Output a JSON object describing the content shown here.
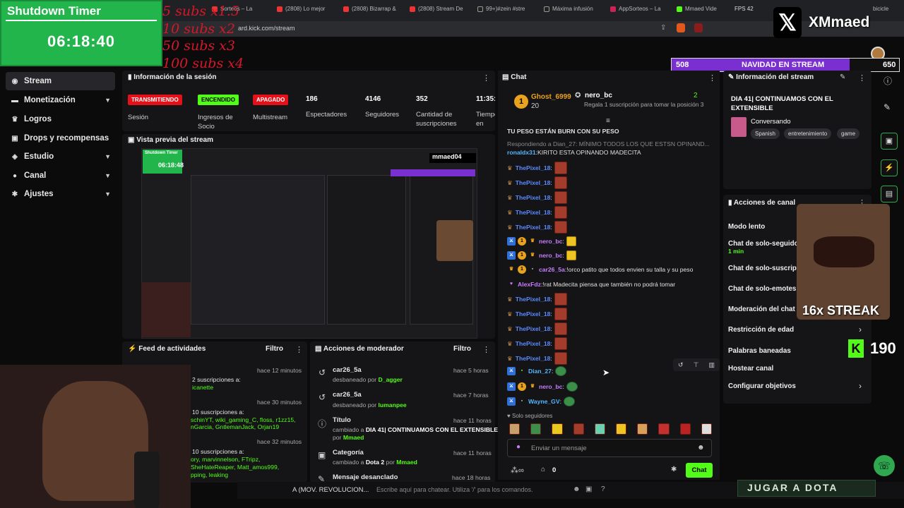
{
  "browser": {
    "tabs": [
      "Sorteos – La",
      "(2808) Lo mejor",
      "(2808) Bizarrap &",
      "(2808) Stream De",
      "99+)#zein #stre",
      "Máxima infusión",
      "AppSorteos – La",
      "Mmaed Vide",
      "FPS 42",
      "bicicle"
    ],
    "url": "ard.kick.com/stream"
  },
  "overlay": {
    "timer_title": "Shutdown Timer",
    "timer_time": "06:18:40",
    "subs_goals": [
      "5 subs x1.5",
      "10 subs x2",
      "50 subs x3",
      "100 subs x4"
    ],
    "x_handle": "XMmaed",
    "goal_left": "508",
    "goal_title": "NAVIDAD EN STREAM",
    "goal_right": "650",
    "streak_text": "16x STREAK",
    "kick_count": "190",
    "jugar": "JUGAR A DOTA"
  },
  "sidebar": {
    "items": [
      {
        "label": "Stream",
        "icon": "stream-icon"
      },
      {
        "label": "Monetización",
        "icon": "money-icon"
      },
      {
        "label": "Logros",
        "icon": "trophy-icon"
      },
      {
        "label": "Drops y recompensas",
        "icon": "gift-icon"
      },
      {
        "label": "Estudio",
        "icon": "studio-icon"
      },
      {
        "label": "Canal",
        "icon": "person-icon"
      },
      {
        "label": "Ajustes",
        "icon": "gear-icon"
      }
    ]
  },
  "session": {
    "title": "Información de la sesión",
    "badges": [
      {
        "text": "TRANSMITIENDO",
        "label": "Sesión",
        "color": "#e4111b"
      },
      {
        "text": "ENCENDIDO",
        "label": "Ingresos de Socio",
        "color": "#53fc18"
      },
      {
        "text": "APAGADO",
        "label": "Multistream",
        "color": "#e4111b"
      }
    ],
    "stats": [
      {
        "value": "186",
        "label": "Espectadores"
      },
      {
        "value": "4146",
        "label": "Seguidores"
      },
      {
        "value": "352",
        "label": "Cantidad de suscripciones"
      },
      {
        "value": "11:35:",
        "label": "Tiempo en vivo"
      }
    ]
  },
  "preview": {
    "title": "Vista previa del stream",
    "mini_timer_title": "Shutdown Timer",
    "mini_timer_time": "06:18:48",
    "mini_handle": "mmaed04"
  },
  "activity": {
    "title": "Feed de actividades",
    "filter": "Filtro",
    "items": [
      {
        "time": "hace 12 minutos",
        "line1": "2 suscripciones a:",
        "line2": "icanette"
      },
      {
        "time": "hace 30 minutos",
        "line1": "10 suscripciones a:",
        "line2": "schinYT, wiki_gaming_C, floss, r1zz15,",
        "line3": "nGarcia, GntlemanJack, Orjan19"
      },
      {
        "time": "hace 32 minutos",
        "line1": "10 suscripciones a:",
        "line2": "ory, marvinnelson, FTripz,",
        "line3": "SheHateReaper, Matt_amos999,",
        "line4": "pping, leaking"
      }
    ]
  },
  "modactions": {
    "title": "Acciones de moderador",
    "filter": "Filtro",
    "items": [
      {
        "name": "car26_5a",
        "time": "hace 5 horas",
        "desc": "desbaneado por",
        "by": "D_agger"
      },
      {
        "name": "car26_5a",
        "time": "hace 7 horas",
        "desc": "desbaneado por",
        "by": "lumanpee"
      },
      {
        "name": "Título",
        "time": "hace 11 horas",
        "desc": "cambiado a",
        "value": "DIA 41| CONTINUAMOS CON EL EXTENSIBLE",
        "by_prefix": "por",
        "by": "Mmaed"
      },
      {
        "name": "Categoría",
        "time": "hace 11 horas",
        "desc": "cambiado a",
        "value": "Dota 2",
        "by_prefix": "por",
        "by": "Mmaed"
      },
      {
        "name": "Mensaje desanclado",
        "time": "hace 18 horas"
      }
    ]
  },
  "chat": {
    "title": "Chat",
    "top_user": "Ghost_6999",
    "top_amount": "20",
    "gift_user": "nero_bc",
    "gift_count": "2",
    "gift_text": "Regala 1 suscripción para tomar la posición 3",
    "messages": [
      {
        "user": "",
        "text": "TU PESO ESTÁN BURN CON SU PESO"
      },
      {
        "user": "",
        "text": "Respondiendo a Dian_27: MÍNIMO TODOS LOS QUE ESTSN OPINAND..."
      },
      {
        "user": "ronaldx31",
        "text": "KIRITO ESTA OPINANDO MADECITA"
      },
      {
        "user": "ThePixel_18",
        "text": ""
      },
      {
        "user": "ThePixel_18",
        "text": ""
      },
      {
        "user": "ThePixel_18",
        "text": ""
      },
      {
        "user": "ThePixel_18",
        "text": ""
      },
      {
        "user": "ThePixel_18",
        "text": ""
      },
      {
        "user": "nero_bc",
        "text": ""
      },
      {
        "user": "nero_bc",
        "text": ""
      },
      {
        "user": "car26_5a",
        "text": "!orco patito que todos envien su talla y su peso"
      },
      {
        "user": "AlexFdz",
        "text": "!rat Madecita piensa que también no podrá tomar"
      },
      {
        "user": "ThePixel_18",
        "text": ""
      },
      {
        "user": "ThePixel_18",
        "text": ""
      },
      {
        "user": "ThePixel_18",
        "text": ""
      },
      {
        "user": "ThePixel_18",
        "text": ""
      },
      {
        "user": "ThePixel_18",
        "text": ""
      },
      {
        "user": "Dian_27",
        "text": ""
      },
      {
        "user": "nero_bc",
        "text": ""
      },
      {
        "user": "Wayne_GV",
        "text": ""
      }
    ],
    "followers_only": "Solo seguidores",
    "input_placeholder": "Enviar un mensaje",
    "viewer_count": "0",
    "send_label": "Chat"
  },
  "stream_info": {
    "title": "Información del stream",
    "stream_title": "DIA 41| CONTINUAMOS CON EL EXTENSIBLE",
    "category": "Conversando",
    "tags": [
      "Spanish",
      "entretenimiento",
      "game"
    ]
  },
  "channel_actions": {
    "title": "Acciones de canal",
    "items": [
      {
        "label": "Modo lento"
      },
      {
        "label": "Chat de solo-seguido",
        "sub": "1 min"
      },
      {
        "label": "Chat de solo-suscript"
      },
      {
        "label": "Chat de solo-emotes"
      },
      {
        "label": "Moderación del chat co"
      },
      {
        "label": "Restricción de edad"
      },
      {
        "label": "Palabras baneadas"
      },
      {
        "label": "Hostear canal"
      },
      {
        "label": "Configurar objetivos"
      }
    ]
  },
  "bottom": {
    "left_text": "A (MOV. REVOLUCION...",
    "hint": "Escribe aquí para chatear. Utiliza '/' para los comandos."
  },
  "colors": {
    "kick_green": "#53fc18",
    "live_red": "#e4111b",
    "goal_purple": "#7a2fd0"
  }
}
